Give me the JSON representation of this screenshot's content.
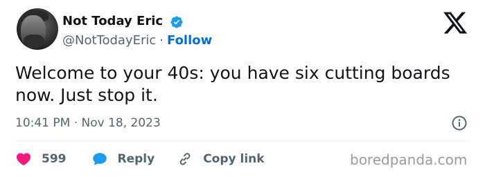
{
  "author": {
    "display_name": "Not Today Eric",
    "handle": "@NotTodayEric",
    "separator": "·",
    "follow_label": "Follow",
    "verified_icon": "verified-badge-icon",
    "avatar": "user-avatar-photo"
  },
  "brand": {
    "logo": "x-logo-icon"
  },
  "tweet": {
    "text": "Welcome to your 40s: you have six cutting boards now. Just stop it.",
    "timestamp": "10:41 PM · Nov 18, 2023"
  },
  "actions": {
    "like_count": "599",
    "reply_label": "Reply",
    "copy_link_label": "Copy link"
  },
  "watermark": "boredpanda.com",
  "colors": {
    "text": "#0f1419",
    "secondary": "#536471",
    "link": "#006fd6",
    "verified": "#1d9bf0",
    "like": "#f91880",
    "reply": "#1d9bf0",
    "divider": "#eff3f4",
    "watermark": "#9a9a9a"
  }
}
